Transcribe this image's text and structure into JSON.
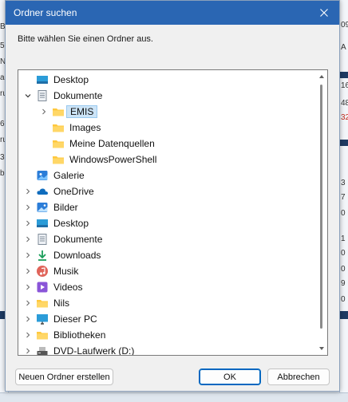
{
  "dialog": {
    "title": "Ordner suchen",
    "prompt": "Bitte wählen Sie einen Ordner aus.",
    "buttons": {
      "new_folder": "Neuen Ordner erstellen",
      "ok": "OK",
      "cancel": "Abbrechen"
    }
  },
  "tree": {
    "items": [
      {
        "label": "Desktop",
        "icon": "desktop-icon",
        "color": "#2b9cd8"
      },
      {
        "label": "Dokumente",
        "icon": "document-icon",
        "color": "#7f8b98"
      },
      {
        "label": "EMIS",
        "icon": "folder-icon",
        "color": "#ffc83d",
        "selected": true
      },
      {
        "label": "Images",
        "icon": "folder-icon",
        "color": "#ffc83d"
      },
      {
        "label": "Meine Datenquellen",
        "icon": "folder-icon",
        "color": "#ffc83d"
      },
      {
        "label": "WindowsPowerShell",
        "icon": "folder-icon",
        "color": "#ffc83d"
      },
      {
        "label": "Galerie",
        "icon": "gallery-icon",
        "color": "#2b7dd8"
      },
      {
        "label": "OneDrive",
        "icon": "cloud-icon",
        "color": "#0f6cbd"
      },
      {
        "label": "Bilder",
        "icon": "pictures-icon",
        "color": "#2b7dd8"
      },
      {
        "label": "Desktop",
        "icon": "desktop-icon",
        "color": "#2b9cd8"
      },
      {
        "label": "Dokumente",
        "icon": "document-icon",
        "color": "#7f8b98"
      },
      {
        "label": "Downloads",
        "icon": "download-icon",
        "color": "#1a9e5a"
      },
      {
        "label": "Musik",
        "icon": "music-icon",
        "color": "#e0645a"
      },
      {
        "label": "Videos",
        "icon": "video-icon",
        "color": "#8a55d8"
      },
      {
        "label": "Nils",
        "icon": "folder-icon",
        "color": "#ffc83d"
      },
      {
        "label": "Dieser PC",
        "icon": "computer-icon",
        "color": "#2b9cd8"
      },
      {
        "label": "Bibliotheken",
        "icon": "folder-icon",
        "color": "#ffc83d"
      },
      {
        "label": "DVD-Laufwerk (D:)",
        "icon": "dvd-drive-icon",
        "color": "#555555"
      }
    ]
  },
  "background": {
    "left_frags": [
      "B",
      "5",
      "Ni",
      "a",
      "ru",
      "6",
      "ru",
      "3",
      "bi"
    ],
    "right_frags": [
      "09",
      "A",
      "16",
      "48",
      "32",
      "3",
      "7",
      "0",
      "1",
      "0",
      "0",
      "9",
      "0"
    ],
    "accent": "#c42b1c"
  },
  "colors": {
    "titlebar": "#2a66b3",
    "selection": "#cce4f7",
    "primary_border": "#0067c0"
  }
}
